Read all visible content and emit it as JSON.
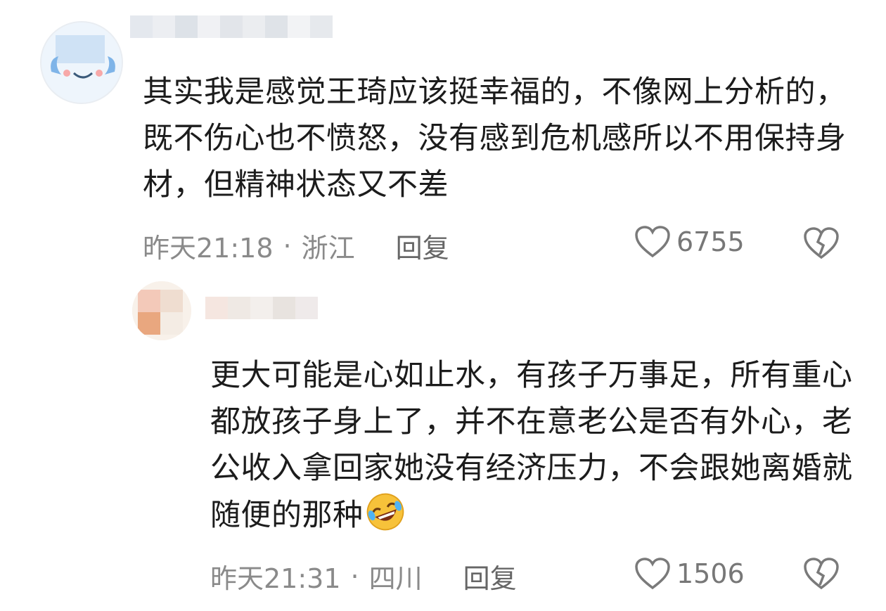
{
  "comments": [
    {
      "text": "其实我是感觉王琦应该挺幸福的，不像网上分析的，既不伤心也不愤怒，没有感到危机感所以不用保持身材，但精神状态又不差",
      "time": "昨天21:18",
      "location": "浙江",
      "reply_label": "回复",
      "likes": "6755"
    },
    {
      "text": "更大可能是心如止水，有孩子万事足，所有重心都放孩子身上了，并不在意老公是否有外心，老公收入拿回家她没有经济压力，不会跟她离婚就随便的那种",
      "time": "昨天21:31",
      "location": "四川",
      "reply_label": "回复",
      "likes": "1506",
      "trailing_emoji": "rofl-emoji"
    }
  ],
  "separator": "·",
  "colors": {
    "meta": "#8a8a8a",
    "text": "#1c1c1c",
    "emoji": "#f7c23a"
  }
}
